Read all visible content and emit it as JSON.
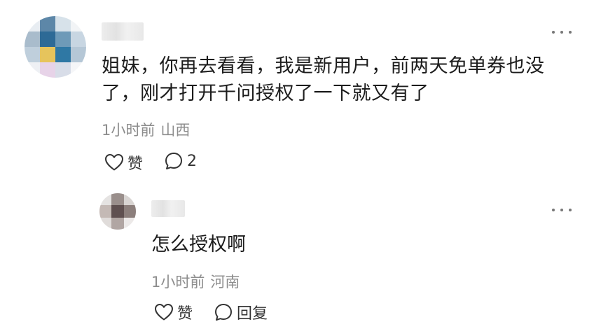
{
  "main_comment": {
    "text": "姐妹，你再去看看，我是新用户，前两天免单券也没了，刚才打开千问授权了一下就又有了",
    "time": "1小时前",
    "location": "山西",
    "like_label": "赞",
    "comment_count": "2",
    "icons": {
      "more": "more-dots-icon",
      "like": "heart-outline-icon",
      "comment": "speech-bubble-icon"
    }
  },
  "reply": {
    "text": "怎么授权啊",
    "time": "1小时前",
    "location": "河南",
    "like_label": "赞",
    "reply_label": "回复",
    "icons": {
      "more": "more-dots-icon",
      "like": "heart-outline-icon",
      "reply": "speech-bubble-icon"
    }
  }
}
